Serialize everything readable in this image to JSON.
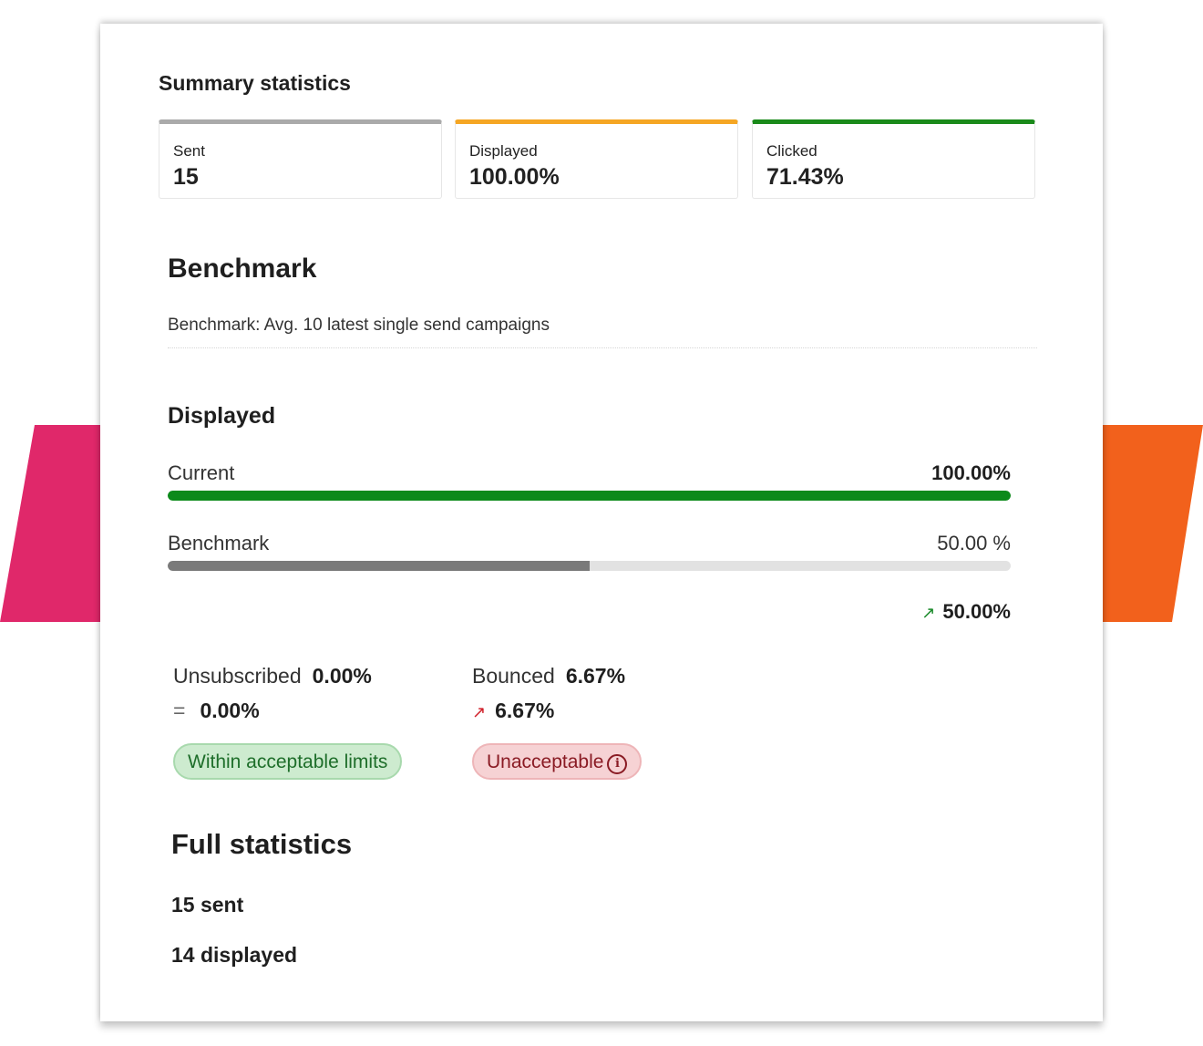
{
  "summary": {
    "title": "Summary statistics",
    "cards": [
      {
        "label": "Sent",
        "value": "15",
        "accent": "#aaaaaa"
      },
      {
        "label": "Displayed",
        "value": "100.00%",
        "accent": "#f5a623"
      },
      {
        "label": "Clicked",
        "value": "71.43%",
        "accent": "#1a8a1a"
      }
    ]
  },
  "benchmark": {
    "title": "Benchmark",
    "description": "Benchmark: Avg. 10 latest single send campaigns"
  },
  "displayed": {
    "title": "Displayed",
    "current": {
      "label": "Current",
      "value": "100.00%",
      "fraction": 1.0,
      "color": "#0c8a1a"
    },
    "benchmark": {
      "label": "Benchmark",
      "value": "50.00 %",
      "fraction": 0.5,
      "color": "#7a7a7a"
    },
    "delta": {
      "icon": "arrow-up-right-icon",
      "value": "50.00%"
    }
  },
  "metrics": {
    "unsubscribed": {
      "label": "Unsubscribed",
      "value": "0.00%",
      "delta_icon": "equals-icon",
      "delta": "0.00%",
      "status": "Within acceptable limits"
    },
    "bounced": {
      "label": "Bounced",
      "value": "6.67%",
      "delta_icon": "arrow-up-right-icon",
      "delta": "6.67%",
      "status": "Unacceptable",
      "status_icon": "info-icon"
    }
  },
  "full_statistics": {
    "title": "Full statistics",
    "items": [
      "15 sent",
      "14 displayed"
    ]
  },
  "colors": {
    "decor_left": "#e0286a",
    "decor_right": "#f2611c",
    "ok_bg": "#cdebcf",
    "bad_bg": "#f6d2d4"
  }
}
